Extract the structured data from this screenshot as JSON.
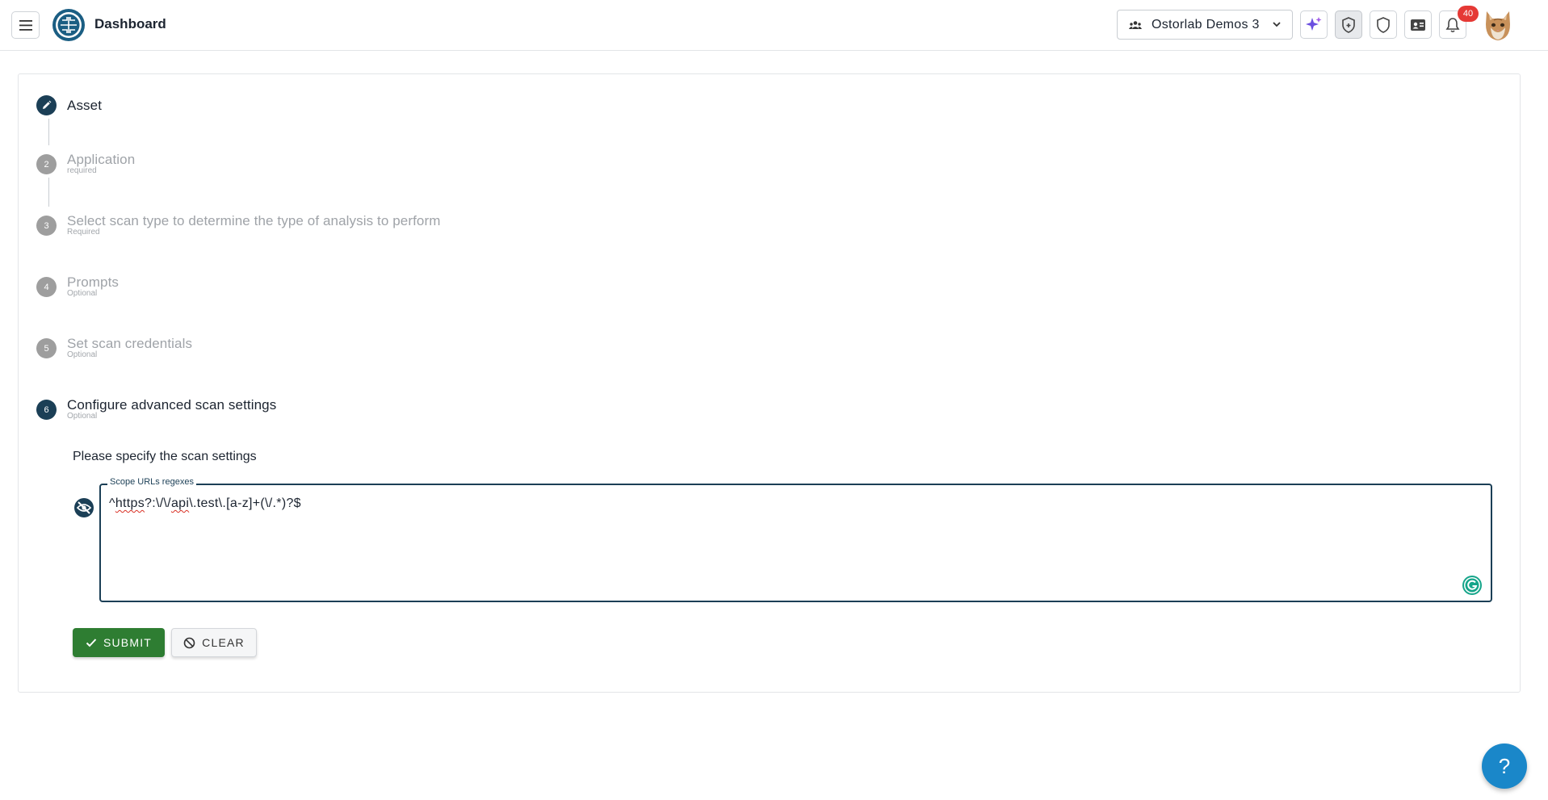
{
  "header": {
    "title": "Dashboard",
    "organization": "Ostorlab Demos 3",
    "notification_count": "40"
  },
  "icons": {
    "menu": "hamburger-menu-icon",
    "logo": "ostorlab-logo",
    "org": "group-icon",
    "org_chevron": "chevron-down-icon",
    "ai": "sparkle-icon",
    "scan": "shield-refresh-icon",
    "security": "shield-icon",
    "contact": "contact-card-icon",
    "notifications": "bell-icon",
    "avatar": "cat-avatar",
    "field": "eye-off-icon",
    "grammarly": "grammarly-icon",
    "submit": "check-icon",
    "clear": "block-icon"
  },
  "steps": [
    {
      "number": "",
      "title": "Asset",
      "subtitle": "",
      "state": "completed"
    },
    {
      "number": "2",
      "title": "Application",
      "subtitle": "required",
      "state": "inactive"
    },
    {
      "number": "3",
      "title": "Select scan type to determine the type of analysis to perform",
      "subtitle": "Required",
      "state": "inactive"
    },
    {
      "number": "4",
      "title": "Prompts",
      "subtitle": "Optional",
      "state": "inactive"
    },
    {
      "number": "5",
      "title": "Set scan credentials",
      "subtitle": "Optional",
      "state": "inactive"
    },
    {
      "number": "6",
      "title": "Configure advanced scan settings",
      "subtitle": "Optional",
      "state": "active"
    }
  ],
  "settings": {
    "section_title": "Please specify the scan settings",
    "scope_label": "Scope URLs regexes",
    "scope_value_parts": [
      "^",
      "https",
      "?:\\/\\/",
      "api",
      "\\.test\\.[a-z]+(\\/.*)?$"
    ]
  },
  "actions": {
    "submit_label": "SUBMIT",
    "clear_label": "CLEAR"
  },
  "help": {
    "label": "?"
  },
  "colors": {
    "primary": "#1b3f56",
    "success": "#2e7d32",
    "badge": "#e53935",
    "fab": "#1a87c9"
  }
}
